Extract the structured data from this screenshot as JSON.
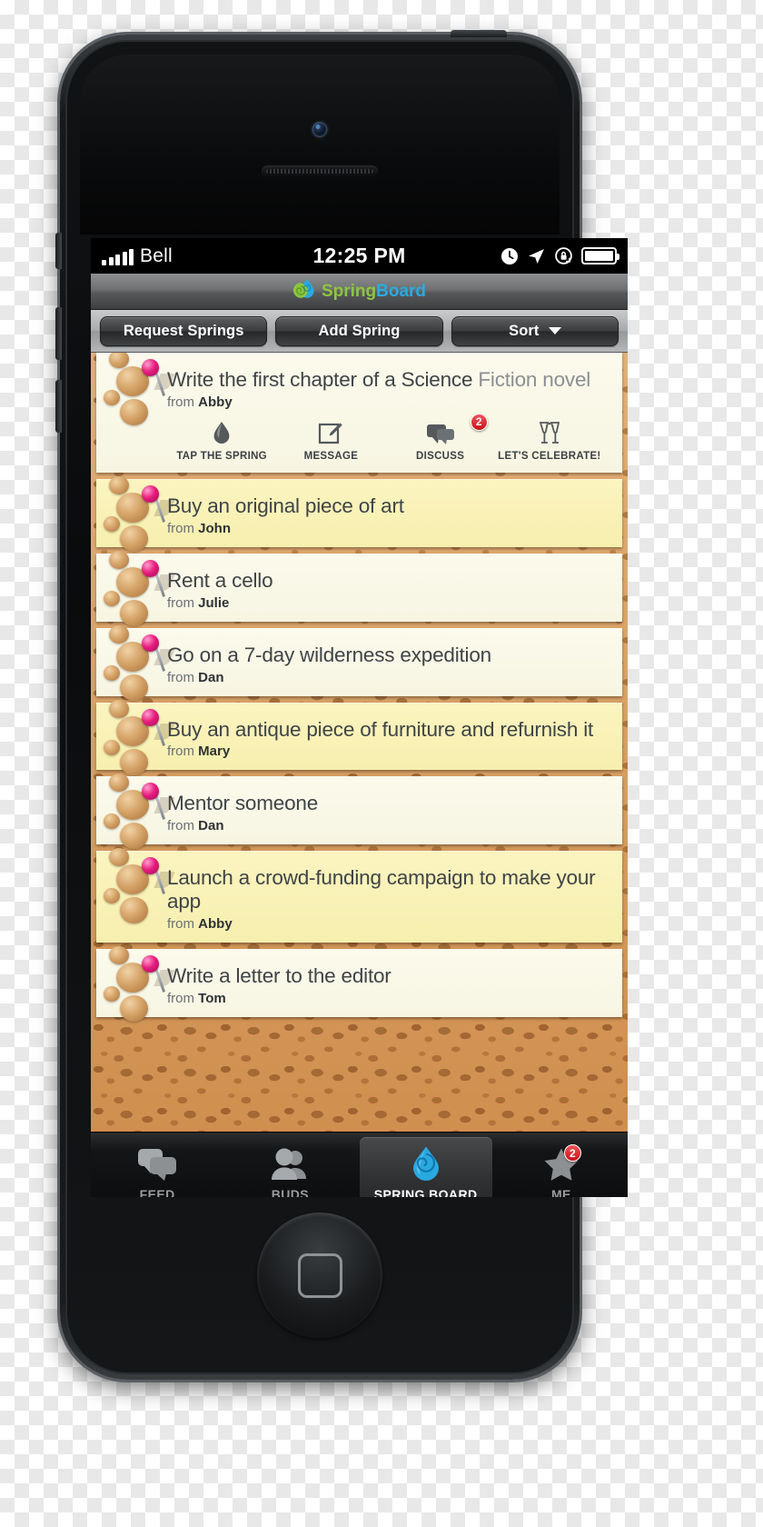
{
  "status_bar": {
    "carrier": "Bell",
    "time": "12:25 PM",
    "icons": [
      "signal-bars-icon",
      "alarm-clock-icon",
      "location-arrow-icon",
      "rotation-lock-icon",
      "battery-icon"
    ]
  },
  "navbar": {
    "brand_first": "Spring",
    "brand_second": "Board",
    "logo_icon": "spring-droplet-logo"
  },
  "toolbar": {
    "request_springs": "Request Springs",
    "add_spring": "Add Spring",
    "sort": "Sort",
    "sort_caret_icon": "chevron-down-icon"
  },
  "actions": [
    {
      "label": "TAP THE SPRING",
      "icon": "droplet-icon",
      "badge": ""
    },
    {
      "label": "MESSAGE",
      "icon": "compose-message-icon",
      "badge": ""
    },
    {
      "label": "DISCUSS",
      "icon": "speech-bubble-icon",
      "badge": "2"
    },
    {
      "label": "LET'S CELEBRATE!",
      "icon": "champagne-glasses-icon",
      "badge": ""
    }
  ],
  "springs": [
    {
      "title_main": "Write the first chapter of a Science",
      "title_muted": " Fiction novel",
      "from_prefix": "from",
      "from_name": "Abby",
      "tone": "cream",
      "expanded": true
    },
    {
      "title_main": "Buy an original piece of art",
      "title_muted": "",
      "from_prefix": "from",
      "from_name": "John",
      "tone": "yellow",
      "expanded": false
    },
    {
      "title_main": "Rent a cello",
      "title_muted": "",
      "from_prefix": "from",
      "from_name": "Julie",
      "tone": "cream",
      "expanded": false
    },
    {
      "title_main": "Go on a 7-day wilderness expedition",
      "title_muted": "",
      "from_prefix": "from",
      "from_name": "Dan",
      "tone": "cream",
      "expanded": false
    },
    {
      "title_main": "Buy an antique piece of furniture and refurnish it",
      "title_muted": "",
      "from_prefix": "from",
      "from_name": "Mary",
      "tone": "yellow",
      "expanded": false
    },
    {
      "title_main": "Mentor someone",
      "title_muted": "",
      "from_prefix": "from",
      "from_name": "Dan",
      "tone": "cream",
      "expanded": false
    },
    {
      "title_main": "Launch a crowd-funding campaign to make your app",
      "title_muted": "",
      "from_prefix": "from",
      "from_name": "Abby",
      "tone": "yellow",
      "expanded": false
    },
    {
      "title_main": "Write a letter to the editor",
      "title_muted": "",
      "from_prefix": "from",
      "from_name": "Tom",
      "tone": "cream",
      "expanded": false
    }
  ],
  "tabbar": [
    {
      "label": "FEED",
      "icon": "chat-bubbles-icon",
      "active": false,
      "badge": ""
    },
    {
      "label": "BUDS",
      "icon": "people-icon",
      "active": false,
      "badge": ""
    },
    {
      "label": "SPRING BOARD",
      "icon": "spring-droplet-icon",
      "active": true,
      "badge": ""
    },
    {
      "label": "ME",
      "icon": "star-icon",
      "active": false,
      "badge": "2"
    }
  ],
  "colors": {
    "brand_green": "#8dc63f",
    "brand_blue": "#29abe2",
    "pin_pink": "#e81e7e",
    "badge_red": "#c9101a",
    "cork": "#d49a5c",
    "note_cream": "#fbfaec",
    "note_yellow": "#fbf4c0"
  }
}
